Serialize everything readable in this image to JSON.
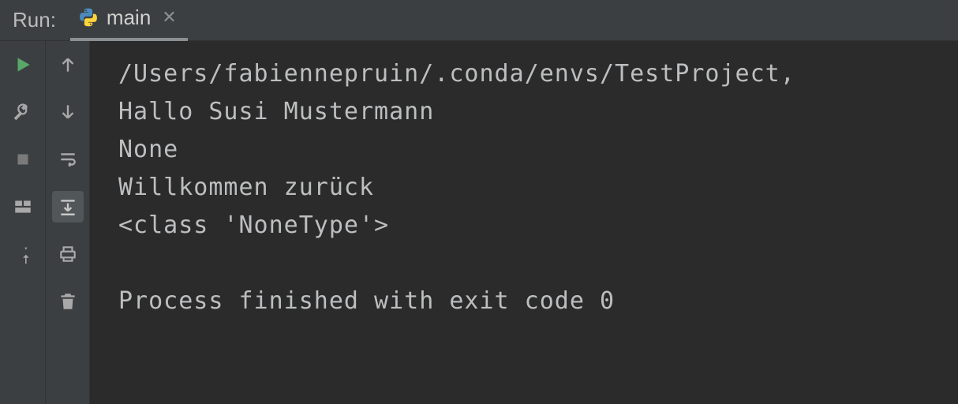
{
  "topbar": {
    "run_label": "Run:",
    "tab_label": "main"
  },
  "console": {
    "lines": [
      "/Users/fabiennepruin/.conda/envs/TestProject,",
      "Hallo Susi Mustermann",
      "None",
      "Willkommen zurück",
      "<class 'NoneType'>"
    ],
    "exit_line": "Process finished with exit code 0"
  },
  "icons": {
    "run": "run-icon",
    "wrench": "wrench-icon",
    "stop": "stop-icon",
    "layout": "layout-icon",
    "pin": "pin-icon",
    "up": "up-arrow-icon",
    "down": "down-arrow-icon",
    "wrap": "soft-wrap-icon",
    "scroll": "scroll-to-end-icon",
    "print": "print-icon",
    "trash": "trash-icon"
  }
}
